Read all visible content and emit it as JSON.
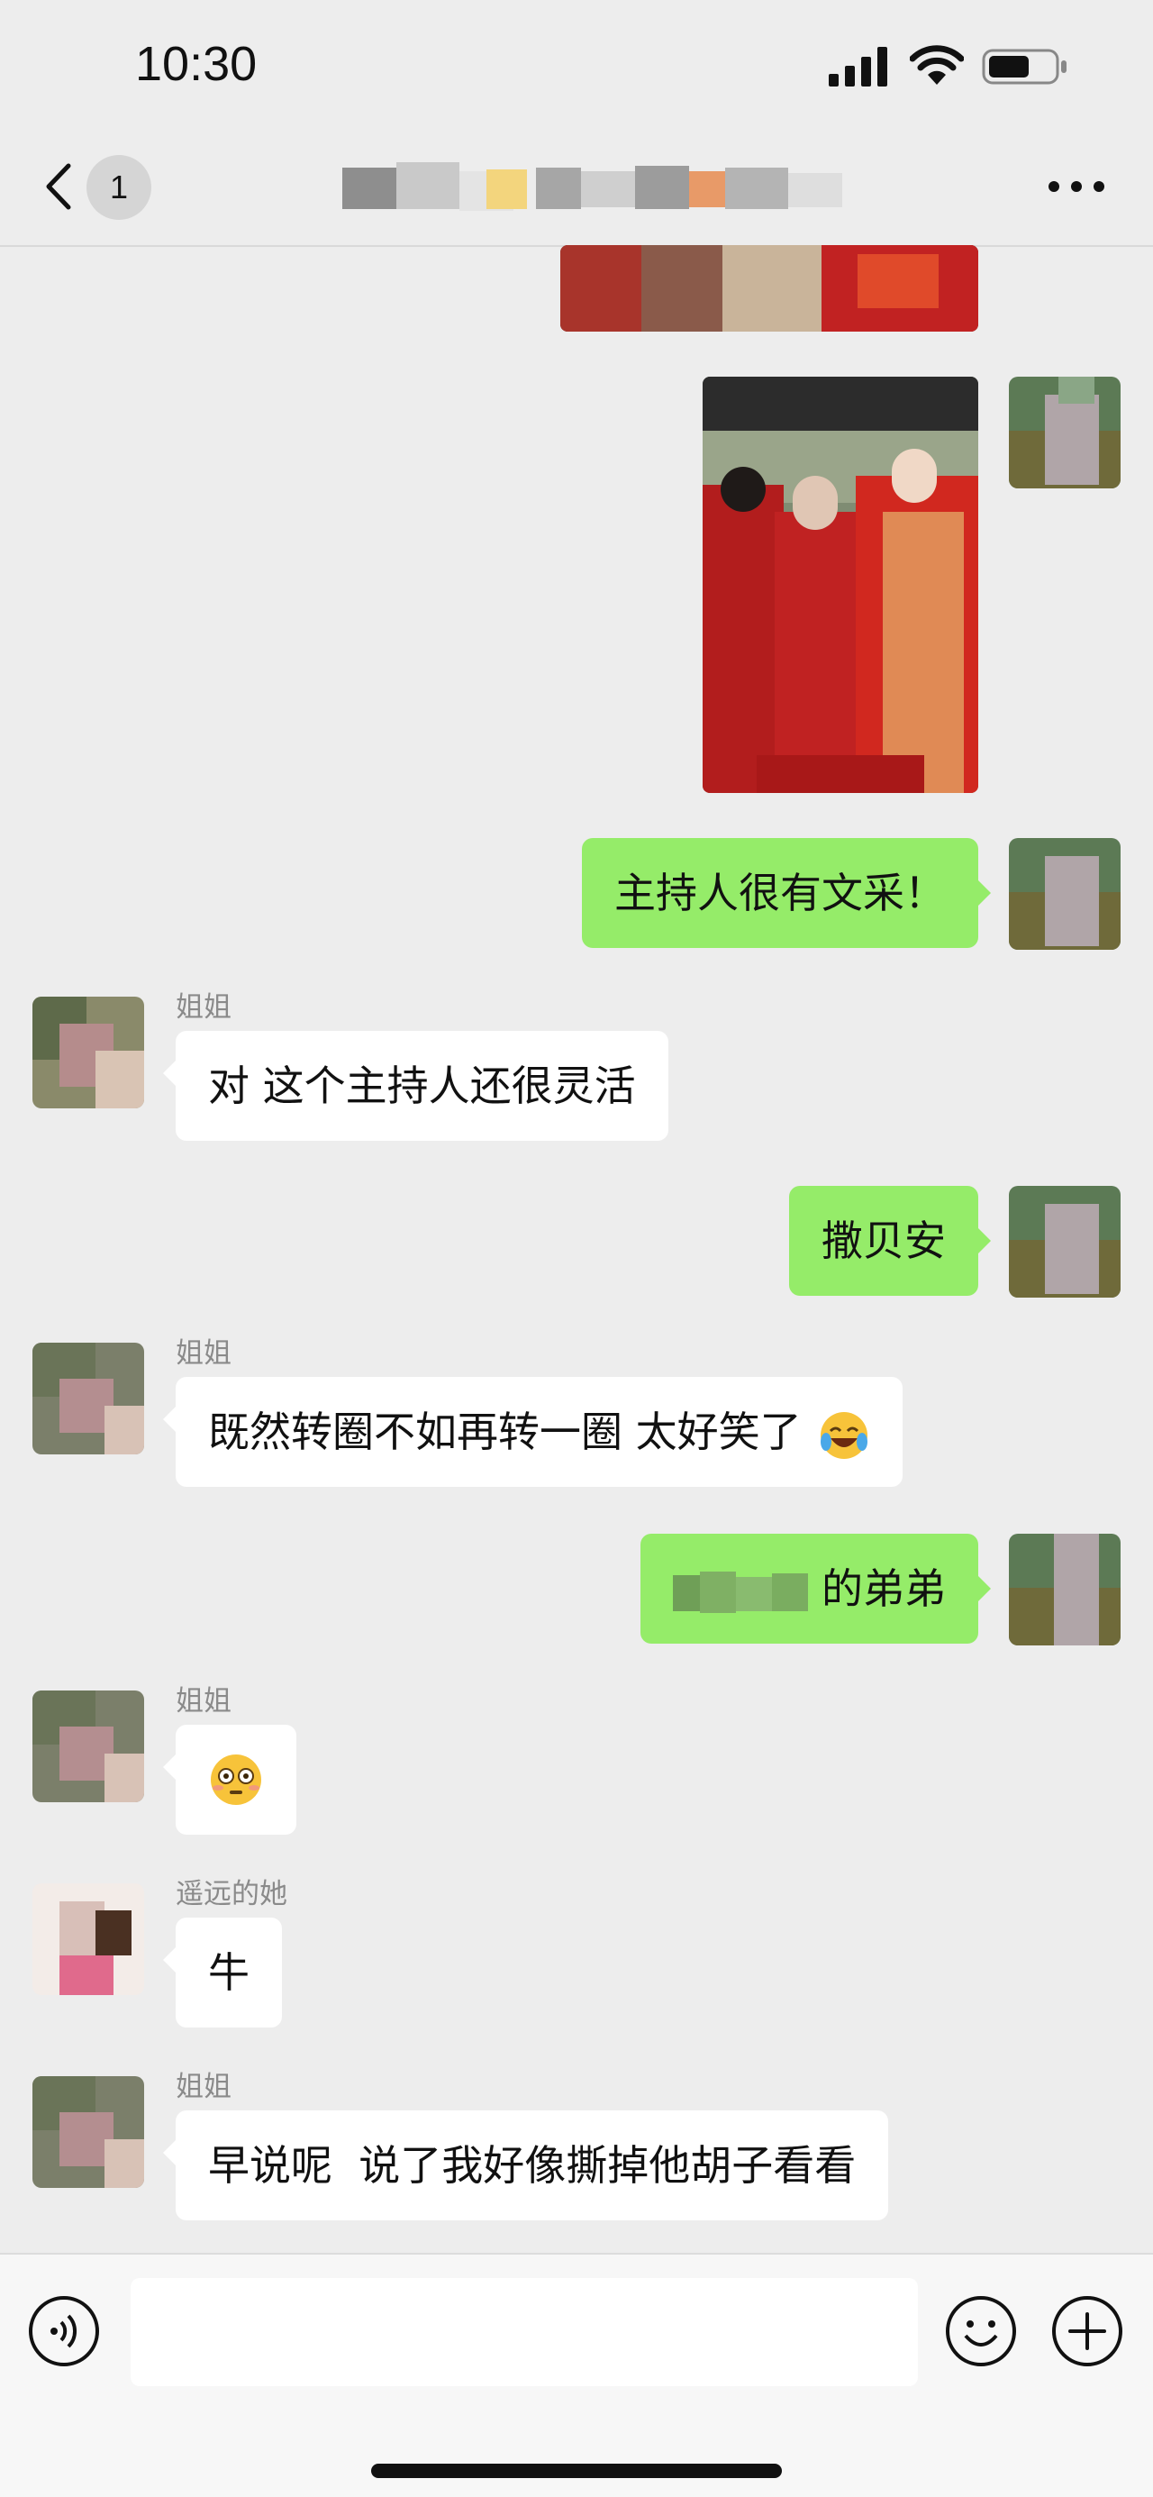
{
  "status_bar": {
    "time": "10:30"
  },
  "nav": {
    "unread_count": "1"
  },
  "messages": [
    {
      "dir": "in",
      "sender": "姐姐",
      "text": "对 这个主持人还很灵活"
    },
    {
      "dir": "out",
      "text": "主持人很有文采！"
    },
    {
      "dir": "out",
      "text": "撒贝安"
    },
    {
      "dir": "in",
      "sender": "姐姐",
      "text": "既然转圈不如再转一圈 太好笑了"
    },
    {
      "dir": "out",
      "text": "的弟弟"
    },
    {
      "dir": "in",
      "sender": "姐姐"
    },
    {
      "dir": "in",
      "sender": "遥远的她",
      "text": "牛"
    },
    {
      "dir": "in",
      "sender": "姐姐",
      "text": "早说呢  说了我好像撕掉他胡子看看"
    }
  ],
  "icons": [
    "back-chevron-icon",
    "more-icon",
    "voice-icon",
    "emoji-icon",
    "plus-icon",
    "laugh-cry-emoji",
    "flushed-emoji"
  ],
  "colors": {
    "background": "#ededed",
    "outgoing_bubble": "#95ec69",
    "incoming_bubble": "#ffffff"
  }
}
